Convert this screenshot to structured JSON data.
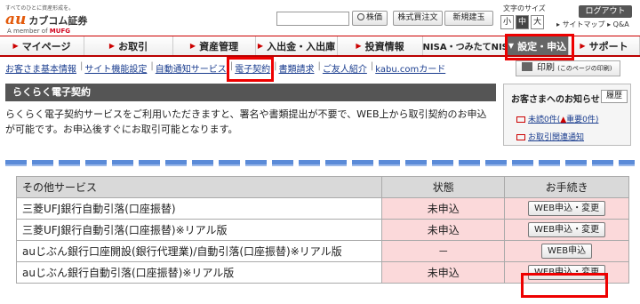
{
  "header": {
    "tagline": "すべてのひとに資産形成を。",
    "logo_au": "au",
    "logo_name": "カブコム証券",
    "member_prefix": "A member of",
    "member_brand": "MUFG",
    "search_placeholder": "",
    "search_btn": "株価",
    "buttons": [
      "株式買注文",
      "新規建玉"
    ],
    "font_size_label": "文字のサイズ",
    "font_sizes": [
      "小",
      "中",
      "大"
    ],
    "logout": "ログアウト",
    "links": [
      "サイトマップ",
      "Q&A"
    ]
  },
  "nav": {
    "items": [
      "マイページ",
      "お取引",
      "資産管理",
      "入出金・入出庫",
      "投資情報",
      "NISA・つみたてNISA",
      "設定・申込",
      "サポート"
    ]
  },
  "subnav": {
    "items": [
      "お客さま基本情報",
      "サイト機能設定",
      "自動通知サービス",
      "電子契約",
      "書類請求",
      "ご友人紹介",
      "kabu.comカード"
    ]
  },
  "print": {
    "label": "印刷",
    "note": "(このページの印刷)"
  },
  "info": {
    "title": "お客さまへのお知らせ",
    "history": "履歴",
    "unread": "未読0件(",
    "important": "重要0件",
    "unread_close": ")",
    "contract": "お取引関連通知"
  },
  "section": {
    "title": "らくらく電子契約",
    "desc": "らくらく電子契約サービスをご利用いただきますと、署名や書類提出が不要で、WEB上から取引契約のお申込が可能です。お申込後すぐにお取引可能となります。"
  },
  "table": {
    "headers": [
      "その他サービス",
      "状態",
      "お手続き"
    ],
    "rows": [
      {
        "name": "三菱UFJ銀行自動引落(口座振替)",
        "state": "未申込",
        "action": "WEB申込・変更"
      },
      {
        "name": "三菱UFJ銀行自動引落(口座振替)※リアル版",
        "state": "未申込",
        "action": "WEB申込・変更"
      },
      {
        "name": "auじぶん銀行口座開設(銀行代理業)/自動引落(口座振替)※リアル版",
        "state": "－",
        "action": "WEB申込"
      },
      {
        "name": "auじぶん銀行自動引落(口座振替)※リアル版",
        "state": "未申込",
        "action": "WEB申込・変更"
      }
    ]
  },
  "colors": {
    "accent": "#e00000",
    "brand": "#e35a0b",
    "status_bg": "#fbd9da"
  }
}
